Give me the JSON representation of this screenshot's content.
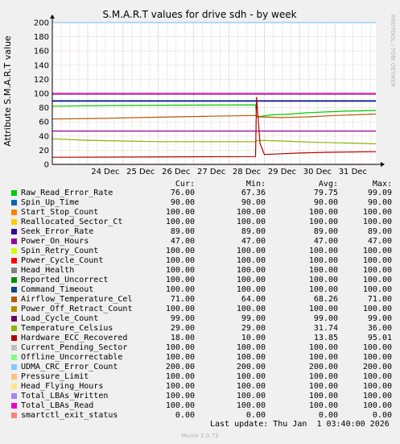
{
  "chart_data": {
    "type": "line",
    "title": "S.M.A.R.T values for drive sdh - by week",
    "ylabel": "Attribute S.M.A.R.T value",
    "side_label": "RRDTOOL / TOBI OETIKER",
    "ylim": [
      0,
      200
    ],
    "yticks": [
      0,
      20,
      40,
      60,
      80,
      100,
      120,
      140,
      160,
      180,
      200
    ],
    "xlim": [
      "2025-12-23 00:00",
      "2026-01-01 03:40"
    ],
    "xticks": [
      "24 Dec",
      "25 Dec",
      "26 Dec",
      "27 Dec",
      "28 Dec",
      "29 Dec",
      "30 Dec",
      "31 Dec"
    ],
    "xtick_dates": [
      "2025-12-24",
      "2025-12-25",
      "2025-12-26",
      "2025-12-27",
      "2025-12-28",
      "2025-12-29",
      "2025-12-30",
      "2025-12-31"
    ],
    "grid": true,
    "columns": [
      "Cur:",
      "Min:",
      "Avg:",
      "Max:"
    ],
    "series": [
      {
        "name": "Raw_Read_Error_Rate",
        "color": "#00cc00",
        "cur": "76.00",
        "min": "67.36",
        "avg": "79.75",
        "max": "99.09",
        "points": [
          [
            "2025-12-23 00:00",
            82
          ],
          [
            "2025-12-24 12:00",
            83
          ],
          [
            "2025-12-26 12:00",
            83.5
          ],
          [
            "2025-12-28 18:00",
            84
          ],
          [
            "2025-12-28 18:40",
            67
          ],
          [
            "2025-12-29 06:00",
            70
          ],
          [
            "2025-12-29 18:00",
            71
          ],
          [
            "2025-12-30 06:00",
            73
          ],
          [
            "2025-12-30 18:00",
            74
          ],
          [
            "2025-12-31 06:00",
            75
          ],
          [
            "2026-01-01 03:40",
            76
          ]
        ]
      },
      {
        "name": "Spin_Up_Time",
        "color": "#0066b3",
        "cur": "90.00",
        "min": "90.00",
        "avg": "90.00",
        "max": "90.00",
        "points": [
          [
            "2025-12-23 00:00",
            90
          ],
          [
            "2026-01-01 03:40",
            90
          ]
        ]
      },
      {
        "name": "Start_Stop_Count",
        "color": "#ff8000",
        "cur": "100.00",
        "min": "100.00",
        "avg": "100.00",
        "max": "100.00",
        "points": [
          [
            "2025-12-23 00:00",
            100
          ],
          [
            "2026-01-01 03:40",
            100
          ]
        ]
      },
      {
        "name": "Reallocated_Sector_Ct",
        "color": "#ffcc00",
        "cur": "100.00",
        "min": "100.00",
        "avg": "100.00",
        "max": "100.00",
        "points": [
          [
            "2025-12-23 00:00",
            100
          ],
          [
            "2026-01-01 03:40",
            100
          ]
        ]
      },
      {
        "name": "Seek_Error_Rate",
        "color": "#330099",
        "cur": "89.00",
        "min": "89.00",
        "avg": "89.00",
        "max": "89.00",
        "points": [
          [
            "2025-12-23 00:00",
            89
          ],
          [
            "2026-01-01 03:40",
            89
          ]
        ]
      },
      {
        "name": "Power_On_Hours",
        "color": "#990099",
        "cur": "47.00",
        "min": "47.00",
        "avg": "47.00",
        "max": "47.00",
        "points": [
          [
            "2025-12-23 00:00",
            47
          ],
          [
            "2026-01-01 03:40",
            47
          ]
        ]
      },
      {
        "name": "Spin_Retry_Count",
        "color": "#ccff00",
        "cur": "100.00",
        "min": "100.00",
        "avg": "100.00",
        "max": "100.00",
        "points": [
          [
            "2025-12-23 00:00",
            100
          ],
          [
            "2026-01-01 03:40",
            100
          ]
        ]
      },
      {
        "name": "Power_Cycle_Count",
        "color": "#ff0000",
        "cur": "100.00",
        "min": "100.00",
        "avg": "100.00",
        "max": "100.00",
        "points": [
          [
            "2025-12-23 00:00",
            100
          ],
          [
            "2026-01-01 03:40",
            100
          ]
        ]
      },
      {
        "name": "Head_Health",
        "color": "#808080",
        "cur": "100.00",
        "min": "100.00",
        "avg": "100.00",
        "max": "100.00",
        "points": [
          [
            "2025-12-23 00:00",
            100
          ],
          [
            "2026-01-01 03:40",
            100
          ]
        ]
      },
      {
        "name": "Reported_Uncorrect",
        "color": "#008f00",
        "cur": "100.00",
        "min": "100.00",
        "avg": "100.00",
        "max": "100.00",
        "points": [
          [
            "2025-12-23 00:00",
            100
          ],
          [
            "2026-01-01 03:40",
            100
          ]
        ]
      },
      {
        "name": "Command_Timeout",
        "color": "#00487d",
        "cur": "100.00",
        "min": "100.00",
        "avg": "100.00",
        "max": "100.00",
        "points": [
          [
            "2025-12-23 00:00",
            100
          ],
          [
            "2026-01-01 03:40",
            100
          ]
        ]
      },
      {
        "name": "Airflow_Temperature_Cel",
        "color": "#b35a00",
        "cur": "71.00",
        "min": "64.00",
        "avg": "68.26",
        "max": "71.00",
        "points": [
          [
            "2025-12-23 00:00",
            64
          ],
          [
            "2025-12-24 12:00",
            65
          ],
          [
            "2025-12-25 12:00",
            66
          ],
          [
            "2025-12-26 12:00",
            67
          ],
          [
            "2025-12-27 12:00",
            68
          ],
          [
            "2025-12-28 18:00",
            69
          ],
          [
            "2025-12-28 19:00",
            67
          ],
          [
            "2025-12-29 12:00",
            66
          ],
          [
            "2025-12-30 06:00",
            67
          ],
          [
            "2025-12-31 00:00",
            69
          ],
          [
            "2026-01-01 03:40",
            71
          ]
        ]
      },
      {
        "name": "Power_Off_Retract_Count",
        "color": "#b38f00",
        "cur": "100.00",
        "min": "100.00",
        "avg": "100.00",
        "max": "100.00",
        "points": [
          [
            "2025-12-23 00:00",
            100
          ],
          [
            "2026-01-01 03:40",
            100
          ]
        ]
      },
      {
        "name": "Load_Cycle_Count",
        "color": "#6b006b",
        "cur": "99.00",
        "min": "99.00",
        "avg": "99.00",
        "max": "99.00",
        "points": [
          [
            "2025-12-23 00:00",
            99
          ],
          [
            "2026-01-01 03:40",
            99
          ]
        ]
      },
      {
        "name": "Temperature_Celsius",
        "color": "#8fb300",
        "cur": "29.00",
        "min": "29.00",
        "avg": "31.74",
        "max": "36.00",
        "points": [
          [
            "2025-12-23 00:00",
            36
          ],
          [
            "2025-12-24 00:00",
            34
          ],
          [
            "2025-12-25 00:00",
            33
          ],
          [
            "2025-12-26 00:00",
            32
          ],
          [
            "2025-12-28 18:00",
            32
          ],
          [
            "2025-12-28 20:00",
            34
          ],
          [
            "2025-12-29 12:00",
            33
          ],
          [
            "2025-12-30 12:00",
            31
          ],
          [
            "2025-12-31 12:00",
            30
          ],
          [
            "2026-01-01 03:40",
            29
          ]
        ]
      },
      {
        "name": "Hardware_ECC_Recovered",
        "color": "#b30000",
        "cur": "18.00",
        "min": "10.00",
        "avg": "13.85",
        "max": "95.01",
        "points": [
          [
            "2025-12-23 00:00",
            10
          ],
          [
            "2025-12-28 18:00",
            11
          ],
          [
            "2025-12-28 18:40",
            95.01
          ],
          [
            "2025-12-28 21:00",
            30
          ],
          [
            "2025-12-29 00:00",
            14
          ],
          [
            "2025-12-29 12:00",
            15
          ],
          [
            "2025-12-30 00:00",
            16
          ],
          [
            "2025-12-30 18:00",
            17
          ],
          [
            "2026-01-01 03:40",
            18
          ]
        ]
      },
      {
        "name": "Current_Pending_Sector",
        "color": "#bebebe",
        "cur": "100.00",
        "min": "100.00",
        "avg": "100.00",
        "max": "100.00",
        "points": [
          [
            "2025-12-23 00:00",
            100
          ],
          [
            "2026-01-01 03:40",
            100
          ]
        ]
      },
      {
        "name": "Offline_Uncorrectable",
        "color": "#80ff80",
        "cur": "100.00",
        "min": "100.00",
        "avg": "100.00",
        "max": "100.00",
        "points": [
          [
            "2025-12-23 00:00",
            100
          ],
          [
            "2026-01-01 03:40",
            100
          ]
        ]
      },
      {
        "name": "UDMA_CRC_Error_Count",
        "color": "#80c9ff",
        "cur": "200.00",
        "min": "200.00",
        "avg": "200.00",
        "max": "200.00",
        "points": [
          [
            "2025-12-23 00:00",
            200
          ],
          [
            "2026-01-01 03:40",
            200
          ]
        ]
      },
      {
        "name": "Pressure_Limit",
        "color": "#ffc080",
        "cur": "100.00",
        "min": "100.00",
        "avg": "100.00",
        "max": "100.00",
        "points": [
          [
            "2025-12-23 00:00",
            100
          ],
          [
            "2026-01-01 03:40",
            100
          ]
        ]
      },
      {
        "name": "Head_Flying_Hours",
        "color": "#ffe680",
        "cur": "100.00",
        "min": "100.00",
        "avg": "100.00",
        "max": "100.00",
        "points": [
          [
            "2025-12-23 00:00",
            100
          ],
          [
            "2026-01-01 03:40",
            100
          ]
        ]
      },
      {
        "name": "Total_LBAs_Written",
        "color": "#aa80ff",
        "cur": "100.00",
        "min": "100.00",
        "avg": "100.00",
        "max": "100.00",
        "points": [
          [
            "2025-12-23 00:00",
            100
          ],
          [
            "2026-01-01 03:40",
            100
          ]
        ]
      },
      {
        "name": "Total_LBAs_Read",
        "color": "#ee00cc",
        "cur": "100.00",
        "min": "100.00",
        "avg": "100.00",
        "max": "100.00",
        "points": [
          [
            "2025-12-23 00:00",
            100
          ],
          [
            "2026-01-01 03:40",
            100
          ]
        ]
      },
      {
        "name": "smartctl_exit_status",
        "color": "#ff8080",
        "cur": "0.00",
        "min": "0.00",
        "avg": "0.00",
        "max": "0.00",
        "points": [
          [
            "2025-12-23 00:00",
            0
          ],
          [
            "2026-01-01 03:40",
            0
          ]
        ]
      }
    ],
    "footer": "Last update: Thu Jan  1 03:40:00 2026",
    "generator": "Munin 2.0.73"
  }
}
